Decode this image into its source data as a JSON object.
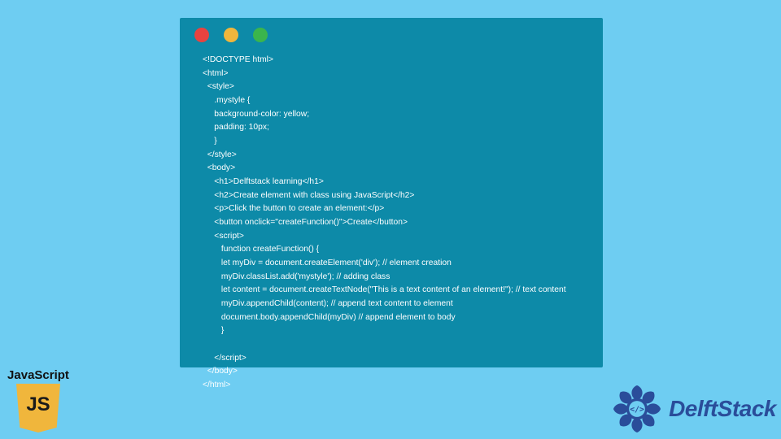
{
  "code_lines": [
    "<!DOCTYPE html>",
    "<html>",
    "  <style>",
    "     .mystyle {",
    "     background-color: yellow;",
    "     padding: 10px;",
    "     }",
    "  </style>",
    "  <body>",
    "     <h1>Delftstack learning</h1>",
    "     <h2>Create element with class using JavaScript</h2>",
    "     <p>Click the button to create an element:</p>",
    "     <button onclick=\"createFunction()\">Create</button>",
    "     <script>",
    "        function createFunction() {",
    "        let myDiv = document.createElement('div'); // element creation",
    "        myDiv.classList.add('mystyle'); // adding class",
    "        let content = document.createTextNode(\"This is a text content of an element!\"); // text content",
    "        myDiv.appendChild(content); // append text content to element",
    "        document.body.appendChild(myDiv) // append element to body",
    "        }",
    "        ",
    "     </script>",
    "  </body>",
    "</html>"
  ],
  "js_badge": {
    "label": "JavaScript",
    "icon_text": "JS"
  },
  "delft": {
    "brand": "DelftStack"
  },
  "colors": {
    "bg": "#6ecdf2",
    "window": "#0d8aa8",
    "red": "#e8433f",
    "yellow": "#f0b63c",
    "green": "#3bb54c",
    "delft_blue": "#2a4d9a"
  }
}
